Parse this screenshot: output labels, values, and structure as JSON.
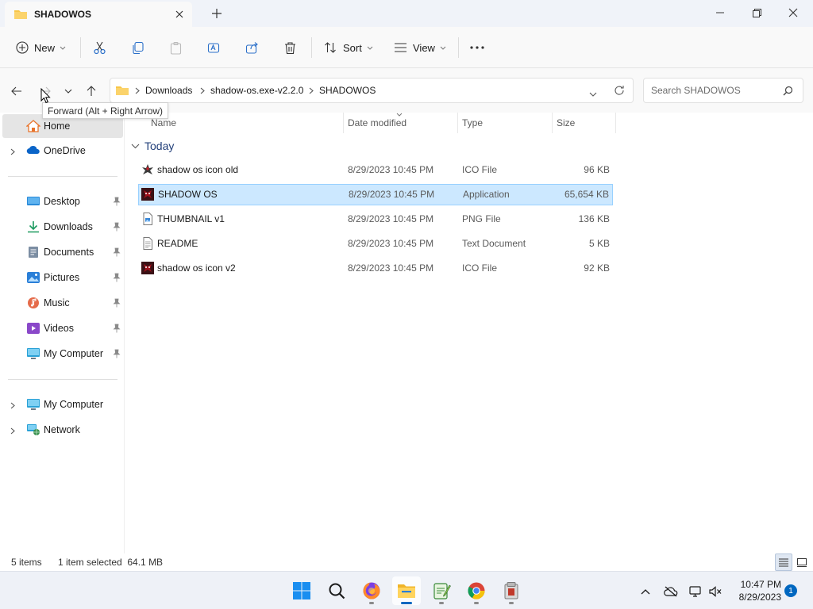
{
  "window": {
    "tab_title": "SHADOWOS"
  },
  "toolbar": {
    "new_label": "New",
    "sort_label": "Sort",
    "view_label": "View"
  },
  "address": {
    "crumbs": [
      "Downloads",
      "shadow-os.exe-v2.2.0",
      "SHADOWOS"
    ]
  },
  "search": {
    "placeholder": "Search SHADOWOS"
  },
  "tooltip": {
    "text": "Forward (Alt + Right Arrow)"
  },
  "sidebar": {
    "items": [
      {
        "label": "Home",
        "icon": "home-icon"
      },
      {
        "label": "OneDrive",
        "icon": "cloud-icon"
      },
      {
        "label": "Desktop",
        "icon": "desktop-icon"
      },
      {
        "label": "Downloads",
        "icon": "download-icon"
      },
      {
        "label": "Documents",
        "icon": "document-icon"
      },
      {
        "label": "Pictures",
        "icon": "picture-icon"
      },
      {
        "label": "Music",
        "icon": "music-icon"
      },
      {
        "label": "Videos",
        "icon": "video-icon"
      },
      {
        "label": "My Computer",
        "icon": "computer-icon"
      },
      {
        "label": "My Computer",
        "icon": "computer-icon"
      },
      {
        "label": "Network",
        "icon": "network-icon"
      }
    ]
  },
  "columns": {
    "name": "Name",
    "date": "Date modified",
    "type": "Type",
    "size": "Size"
  },
  "group": {
    "label": "Today"
  },
  "files": [
    {
      "name": "shadow os icon old",
      "date": "8/29/2023 10:45 PM",
      "type": "ICO File",
      "size": "96 KB"
    },
    {
      "name": "SHADOW OS",
      "date": "8/29/2023 10:45 PM",
      "type": "Application",
      "size": "65,654 KB"
    },
    {
      "name": "THUMBNAIL v1",
      "date": "8/29/2023 10:45 PM",
      "type": "PNG File",
      "size": "136 KB"
    },
    {
      "name": "README",
      "date": "8/29/2023 10:45 PM",
      "type": "Text Document",
      "size": "5 KB"
    },
    {
      "name": "shadow os icon v2",
      "date": "8/29/2023 10:45 PM",
      "type": "ICO File",
      "size": "92 KB"
    }
  ],
  "status": {
    "count": "5 items",
    "selection": "1 item selected  64.1 MB"
  },
  "clock": {
    "time": "10:47 PM",
    "date": "8/29/2023"
  },
  "notifications": {
    "count": "1"
  },
  "colors": {
    "accent": "#0067c0",
    "selection_bg": "#cce8ff",
    "folder": "#f8c648"
  }
}
